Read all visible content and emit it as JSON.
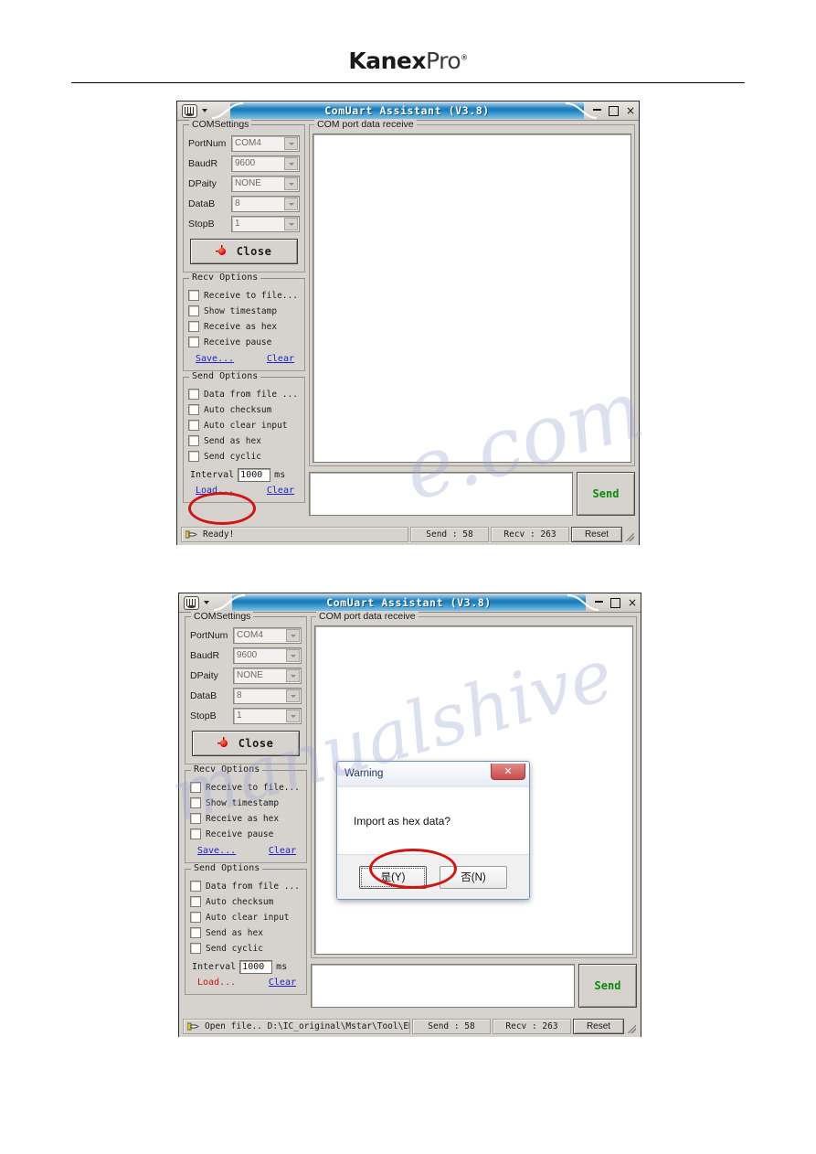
{
  "page": {
    "brand_bold": "Kanex",
    "brand_light": "Pro",
    "brand_mark": "®",
    "watermark_1": "e.com",
    "watermark_2": "manualshive"
  },
  "app": {
    "title": "ComUart Assistant  (V3.8)",
    "titlebar_icon": "serial-port-icon",
    "caret_icon": "chevron-down-icon",
    "minimize_label": "–",
    "maximize_label": "❐",
    "close_label": "×",
    "com_settings": {
      "group_title": "COMSettings",
      "fields": [
        {
          "label": "PortNum",
          "value": "COM4"
        },
        {
          "label": "BaudR",
          "value": "9600"
        },
        {
          "label": "DPaity",
          "value": "NONE"
        },
        {
          "label": "DataB",
          "value": "8"
        },
        {
          "label": "StopB",
          "value": "1"
        }
      ],
      "connect_button": "Close",
      "led_icon": "red-led-icon"
    },
    "recv_options": {
      "group_title": "Recv Options",
      "checkboxes": [
        "Receive to file...",
        "Show timestamp",
        "Receive as hex",
        "Receive pause"
      ],
      "save_link": "Save...",
      "clear_link": "Clear"
    },
    "send_options": {
      "group_title": "Send Options",
      "checkboxes": [
        "Data from file ...",
        "Auto checksum",
        "Auto clear input",
        "Send as hex",
        "Send cyclic"
      ],
      "interval_label": "Interval",
      "interval_value": "1000",
      "interval_unit": "ms",
      "load_link": "Load...",
      "clear_link": "Clear"
    },
    "receive_panel": {
      "title": "COM port data receive",
      "content": ""
    },
    "send_panel": {
      "input_value": "",
      "send_button": "Send"
    },
    "statusbar": {
      "status_ready": "Ready!",
      "status_open_file": "Open file.. D:\\IC_original\\Mstar\\Tool\\EDID Tool",
      "send_count": "Send : 58",
      "recv_count": "Recv : 263",
      "reset_button": "Reset",
      "hand_icon": "pointing-hand-icon",
      "grip_icon": "resize-grip-icon"
    }
  },
  "dialog": {
    "title": "Warning",
    "close_label": "✕",
    "message": "Import as hex data?",
    "yes_button": "是(Y)",
    "no_button": "否(N)"
  },
  "annotations": {
    "circle_load": "red-ellipse-load",
    "circle_yes": "red-ellipse-yes"
  },
  "colors": {
    "title_blue": "#1a7ab8",
    "annotation_red": "#d01515",
    "send_green": "#0a8a0a",
    "link_blue": "#2222cc",
    "link_red": "#cc1111"
  }
}
